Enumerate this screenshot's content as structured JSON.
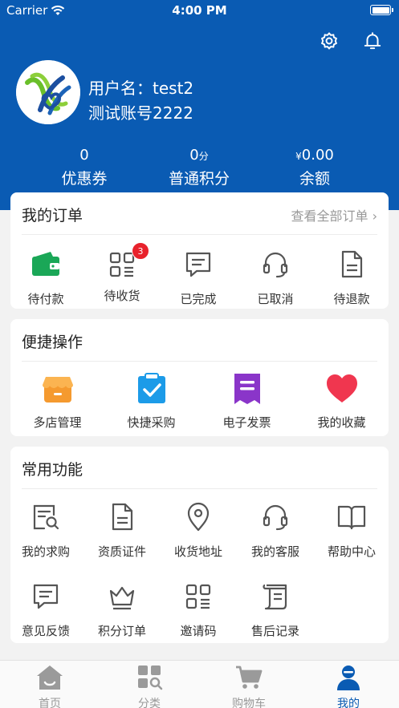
{
  "status_bar": {
    "carrier": "Carrier",
    "time": "4:00 PM"
  },
  "header": {
    "settings_icon": "gear-icon",
    "notification_icon": "bell-icon",
    "user_name": "用户名：test2",
    "account": "测试账号2222",
    "stats": {
      "coupons": {
        "value": "0",
        "label": "优惠券"
      },
      "points": {
        "value": "0",
        "unit": "分",
        "label": "普通积分"
      },
      "balance": {
        "prefix": "¥",
        "value": "0.00",
        "label": "余额"
      }
    }
  },
  "orders": {
    "title": "我的订单",
    "view_all": "查看全部订单 ›",
    "items": [
      {
        "label": "待付款",
        "icon": "wallet-icon"
      },
      {
        "label": "待收货",
        "icon": "package-grid-icon",
        "badge": "3"
      },
      {
        "label": "已完成",
        "icon": "message-done-icon"
      },
      {
        "label": "已取消",
        "icon": "headset-icon"
      },
      {
        "label": "待退款",
        "icon": "document-icon"
      }
    ]
  },
  "quick": {
    "title": "便捷操作",
    "items": [
      {
        "label": "多店管理",
        "icon": "store-icon"
      },
      {
        "label": "快捷采购",
        "icon": "clipboard-check-icon"
      },
      {
        "label": "电子发票",
        "icon": "invoice-icon"
      },
      {
        "label": "我的收藏",
        "icon": "heart-icon"
      }
    ]
  },
  "common": {
    "title": "常用功能",
    "items": [
      {
        "label": "我的求购",
        "icon": "search-document-icon"
      },
      {
        "label": "资质证件",
        "icon": "certificate-icon"
      },
      {
        "label": "收货地址",
        "icon": "location-pin-icon"
      },
      {
        "label": "我的客服",
        "icon": "headset-icon"
      },
      {
        "label": "帮助中心",
        "icon": "book-icon"
      },
      {
        "label": "意见反馈",
        "icon": "feedback-icon"
      },
      {
        "label": "积分订单",
        "icon": "crown-icon"
      },
      {
        "label": "邀请码",
        "icon": "qrcode-icon"
      },
      {
        "label": "售后记录",
        "icon": "record-icon"
      }
    ]
  },
  "tabbar": {
    "items": [
      {
        "label": "首页",
        "icon": "home-icon"
      },
      {
        "label": "分类",
        "icon": "category-icon"
      },
      {
        "label": "购物车",
        "icon": "cart-icon"
      },
      {
        "label": "我的",
        "icon": "profile-icon",
        "active": true
      }
    ]
  },
  "colors": {
    "primary": "#0a5bb3",
    "badge": "#e8222c",
    "wallet": "#1aa757",
    "heart": "#f0364f"
  }
}
